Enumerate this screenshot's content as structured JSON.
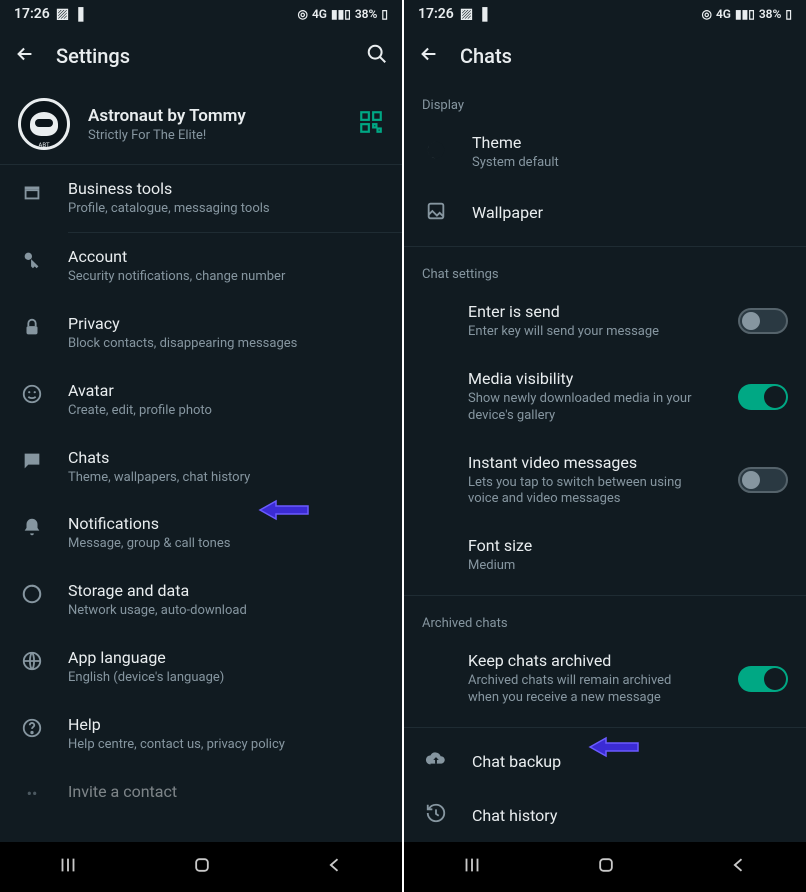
{
  "statusbar": {
    "time": "17:26",
    "net": "4G",
    "battery": "38%"
  },
  "left": {
    "appbar": {
      "title": "Settings"
    },
    "profile": {
      "name": "Astronaut by Tommy",
      "status": "Strictly For The Elite!"
    },
    "items": [
      {
        "label": "Business tools",
        "sub": "Profile, catalogue, messaging tools"
      },
      {
        "label": "Account",
        "sub": "Security notifications, change number"
      },
      {
        "label": "Privacy",
        "sub": "Block contacts, disappearing messages"
      },
      {
        "label": "Avatar",
        "sub": "Create, edit, profile photo"
      },
      {
        "label": "Chats",
        "sub": "Theme, wallpapers, chat history"
      },
      {
        "label": "Notifications",
        "sub": "Message, group & call tones"
      },
      {
        "label": "Storage and data",
        "sub": "Network usage, auto-download"
      },
      {
        "label": "App language",
        "sub": "English (device's language)"
      },
      {
        "label": "Help",
        "sub": "Help centre, contact us, privacy policy"
      },
      {
        "label": "Invite a contact",
        "sub": ""
      }
    ]
  },
  "right": {
    "appbar": {
      "title": "Chats"
    },
    "sections": {
      "display": "Display",
      "chat_settings": "Chat settings",
      "archived": "Archived chats"
    },
    "display_items": [
      {
        "label": "Theme",
        "sub": "System default"
      },
      {
        "label": "Wallpaper",
        "sub": ""
      }
    ],
    "chat_settings_items": [
      {
        "label": "Enter is send",
        "sub": "Enter key will send your message",
        "toggle": "off"
      },
      {
        "label": "Media visibility",
        "sub": "Show newly downloaded media in your device's gallery",
        "toggle": "on"
      },
      {
        "label": "Instant video messages",
        "sub": "Lets you tap to switch between using voice and video messages",
        "toggle": "off"
      },
      {
        "label": "Font size",
        "sub": "Medium"
      }
    ],
    "archived_items": [
      {
        "label": "Keep chats archived",
        "sub": "Archived chats will remain archived when you receive a new message",
        "toggle": "on"
      }
    ],
    "bottom_items": [
      {
        "label": "Chat backup"
      },
      {
        "label": "Chat history"
      }
    ]
  }
}
